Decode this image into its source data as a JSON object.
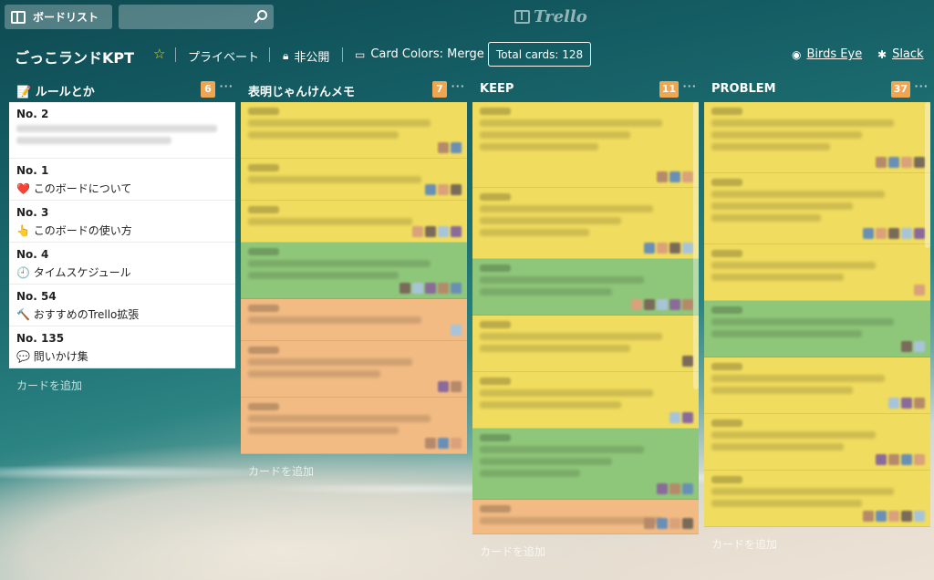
{
  "topbar": {
    "boards_label": "ボードリスト",
    "search_value": "",
    "logo_text": "Trello"
  },
  "board": {
    "title": "ごっこランドKPT",
    "visibility": "プライベート",
    "privacy": "非公開",
    "card_colors": "Card Colors: Merge",
    "total_cards": "Total cards: 128",
    "birds_eye": "Birds Eye",
    "slack": "Slack"
  },
  "colors": {
    "yellow": "#f0dc5e",
    "green": "#8fc77a",
    "orange": "#f2bb84",
    "count_badge": "#f0a550"
  },
  "lists": [
    {
      "title": "📝 ルールとか",
      "count": "6",
      "add_label": "カードを追加",
      "cards": [
        {
          "no": "No. 2",
          "text": "",
          "color": "white",
          "blurred": true
        },
        {
          "no": "No. 1",
          "text": "❤️ このボードについて",
          "color": "white"
        },
        {
          "no": "No. 3",
          "text": "👆 このボードの使い方",
          "color": "white"
        },
        {
          "no": "No. 4",
          "text": "🕘 タイムスケジュール",
          "color": "white"
        },
        {
          "no": "No. 54",
          "text": "🔨 おすすめのTrello拡張",
          "color": "white"
        },
        {
          "no": "No. 135",
          "text": "💬 問いかけ集",
          "color": "white"
        }
      ]
    },
    {
      "title": "表明じゃんけんメモ",
      "count": "7",
      "add_label": "カードを追加",
      "cards": [
        {
          "color": "yellow"
        },
        {
          "color": "yellow"
        },
        {
          "color": "yellow"
        },
        {
          "color": "green"
        },
        {
          "color": "orange"
        },
        {
          "color": "orange"
        },
        {
          "color": "orange"
        }
      ]
    },
    {
      "title": "KEEP",
      "count": "11",
      "add_label": "カードを追加",
      "cards": [
        {
          "color": "yellow"
        },
        {
          "color": "yellow"
        },
        {
          "color": "green"
        },
        {
          "color": "yellow"
        },
        {
          "color": "yellow"
        },
        {
          "color": "green"
        },
        {
          "color": "orange"
        }
      ]
    },
    {
      "title": "PROBLEM",
      "count": "37",
      "add_label": "カードを追加",
      "cards": [
        {
          "color": "yellow"
        },
        {
          "color": "yellow"
        },
        {
          "color": "yellow"
        },
        {
          "color": "green"
        },
        {
          "color": "yellow"
        },
        {
          "color": "yellow"
        },
        {
          "color": "yellow"
        }
      ]
    }
  ]
}
